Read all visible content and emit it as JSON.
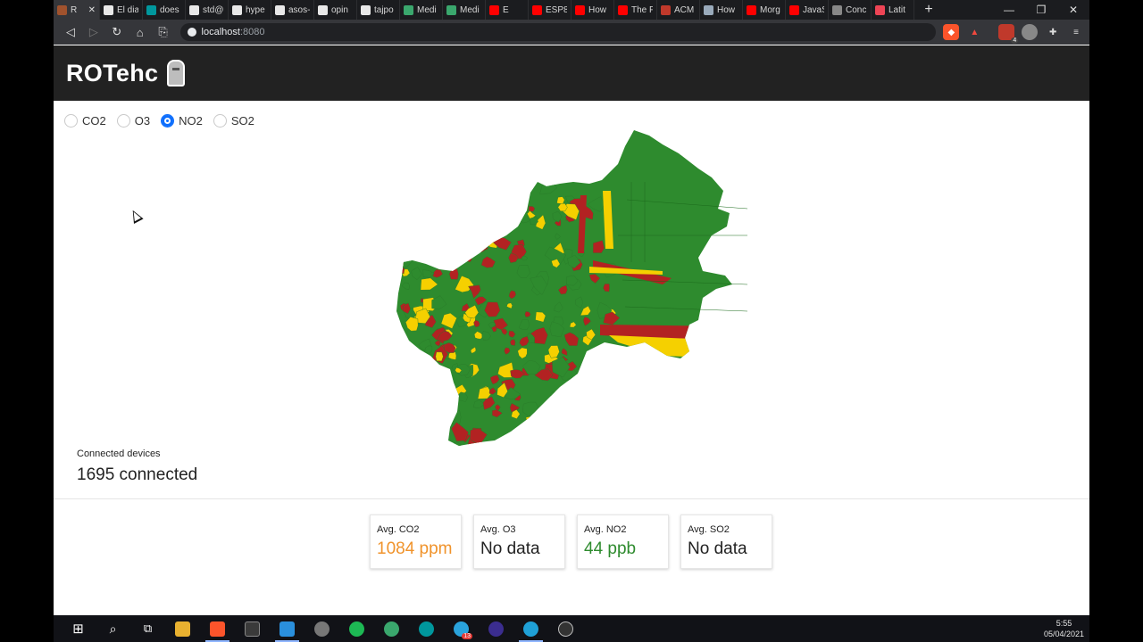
{
  "browser": {
    "tabs": [
      {
        "title": "R",
        "color": "#a0522d",
        "active": true
      },
      {
        "title": "El dia",
        "color": "#e8e8e8"
      },
      {
        "title": "does",
        "color": "#00979d"
      },
      {
        "title": "std@",
        "color": "#e8e8e8"
      },
      {
        "title": "hype",
        "color": "#e8e8e8"
      },
      {
        "title": "asos-",
        "color": "#e8e8e8"
      },
      {
        "title": "opin",
        "color": "#e8e8e8"
      },
      {
        "title": "tajpo",
        "color": "#e8e8e8"
      },
      {
        "title": "Medi",
        "color": "#3aa76d"
      },
      {
        "title": "Medi",
        "color": "#3aa76d"
      },
      {
        "title": "E",
        "color": "#ff0000"
      },
      {
        "title": "ESP8",
        "color": "#ff0000"
      },
      {
        "title": "How",
        "color": "#ff0000"
      },
      {
        "title": "The F",
        "color": "#ff0000"
      },
      {
        "title": "ACM",
        "color": "#c0392b"
      },
      {
        "title": "How",
        "color": "#9ab"
      },
      {
        "title": "Morg",
        "color": "#ff0000"
      },
      {
        "title": "JavaS",
        "color": "#ff0000"
      },
      {
        "title": "Conc",
        "color": "#888"
      },
      {
        "title": "Latit",
        "color": "#e45"
      }
    ],
    "new_tab": "+",
    "close_tab": "✕",
    "url_host": "localhost",
    "url_port": ":8080",
    "notif_count": "4"
  },
  "app": {
    "title": "ROTehc"
  },
  "pollutants": [
    {
      "label": "CO2",
      "checked": false
    },
    {
      "label": "O3",
      "checked": false
    },
    {
      "label": "NO2",
      "checked": true
    },
    {
      "label": "SO2",
      "checked": false
    }
  ],
  "devices": {
    "label": "Connected devices",
    "count": "1695 connected"
  },
  "stats": [
    {
      "label": "Avg. CO2",
      "value": "1084 ppm",
      "color": "#f0932b"
    },
    {
      "label": "Avg. O3",
      "value": "No data",
      "color": "#222222"
    },
    {
      "label": "Avg. NO2",
      "value": "44 ppb",
      "color": "#2e8b2e"
    },
    {
      "label": "Avg. SO2",
      "value": "No data",
      "color": "#222222"
    }
  ],
  "map_colors": {
    "good": "#2e8b2e",
    "moderate": "#f5d000",
    "bad": "#b22222"
  },
  "taskbar": {
    "time": "5:55",
    "date": "05/04/2021",
    "telegram_badge": "13"
  }
}
